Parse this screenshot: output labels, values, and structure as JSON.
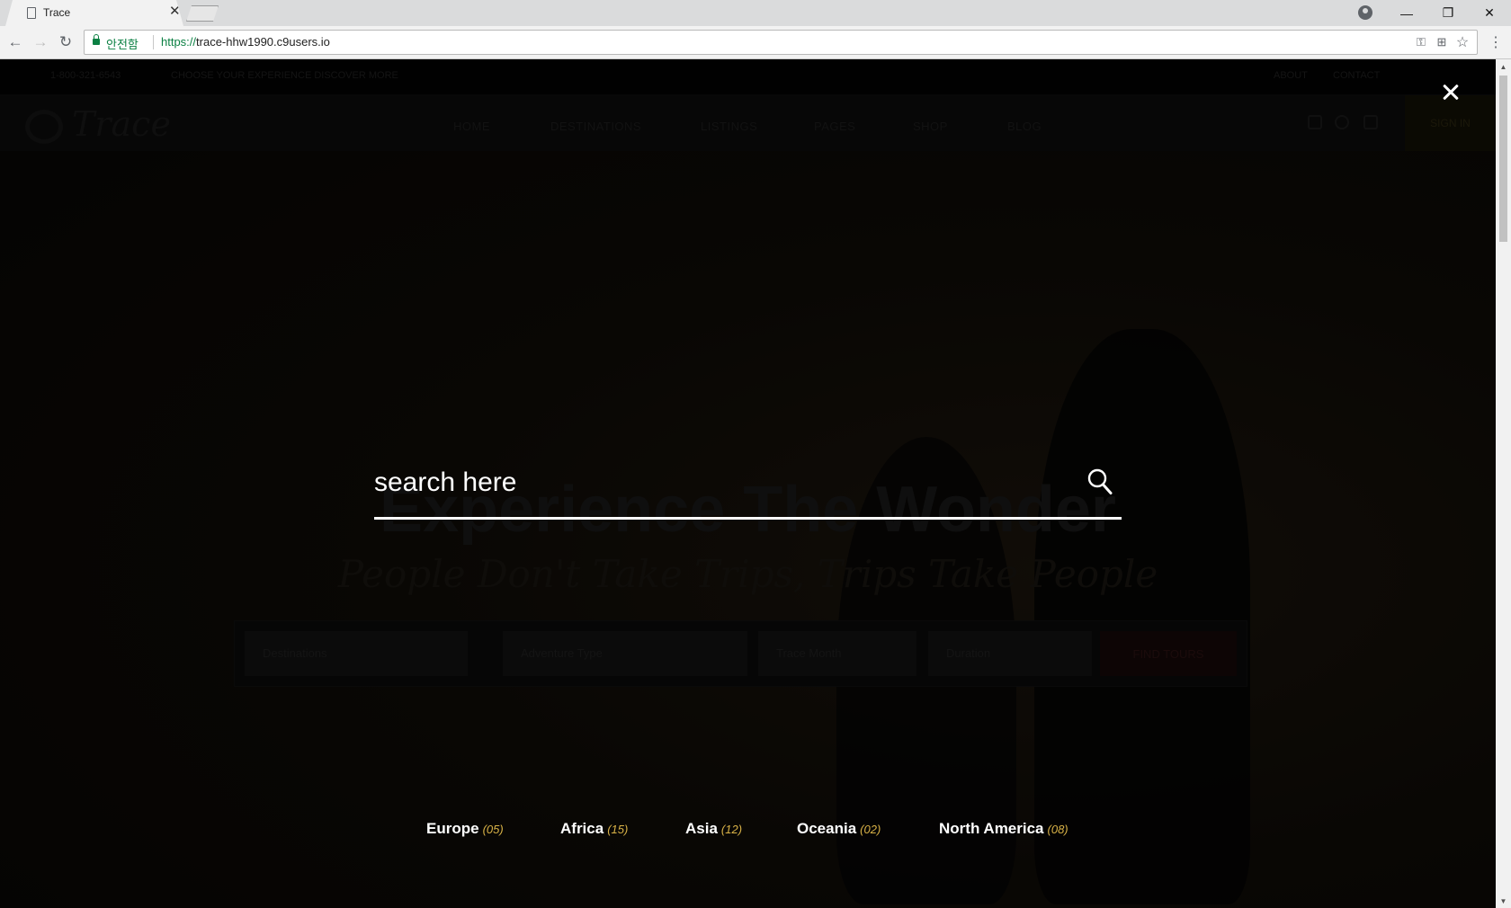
{
  "browser": {
    "tab_title": "Trace",
    "secure_label": "안전함",
    "url_scheme": "https://",
    "url_host": "trace-hhw1990.c9users.io"
  },
  "site": {
    "topbar": {
      "phone": "1-800-321-6543",
      "tagline": "CHOOSE YOUR EXPERIENCE DISCOVER MORE",
      "about": "ABOUT",
      "contact": "CONTACT"
    },
    "logo_text": "Trace",
    "nav": [
      "HOME",
      "DESTINATIONS",
      "LISTINGS",
      "PAGES",
      "SHOP",
      "BLOG"
    ],
    "signin": "SIGN IN",
    "hero_title": "Experience The Wonder",
    "hero_subtitle": "People Don't Take Trips, Trips Take People",
    "form": {
      "destinations": "Destinations",
      "adventure": "Adventure Type",
      "month": "Trace Month",
      "duration": "Duration",
      "button": "FIND TOURS"
    }
  },
  "search_overlay": {
    "placeholder": "search here"
  },
  "continents": [
    {
      "name": "Europe",
      "count": "(05)"
    },
    {
      "name": "Africa",
      "count": "(15)"
    },
    {
      "name": "Asia",
      "count": "(12)"
    },
    {
      "name": "Oceania",
      "count": "(02)"
    },
    {
      "name": "North America",
      "count": "(08)"
    }
  ],
  "colors": {
    "accent": "#d9b247",
    "secure": "#0b8043",
    "overlay_text": "#ffffff"
  }
}
